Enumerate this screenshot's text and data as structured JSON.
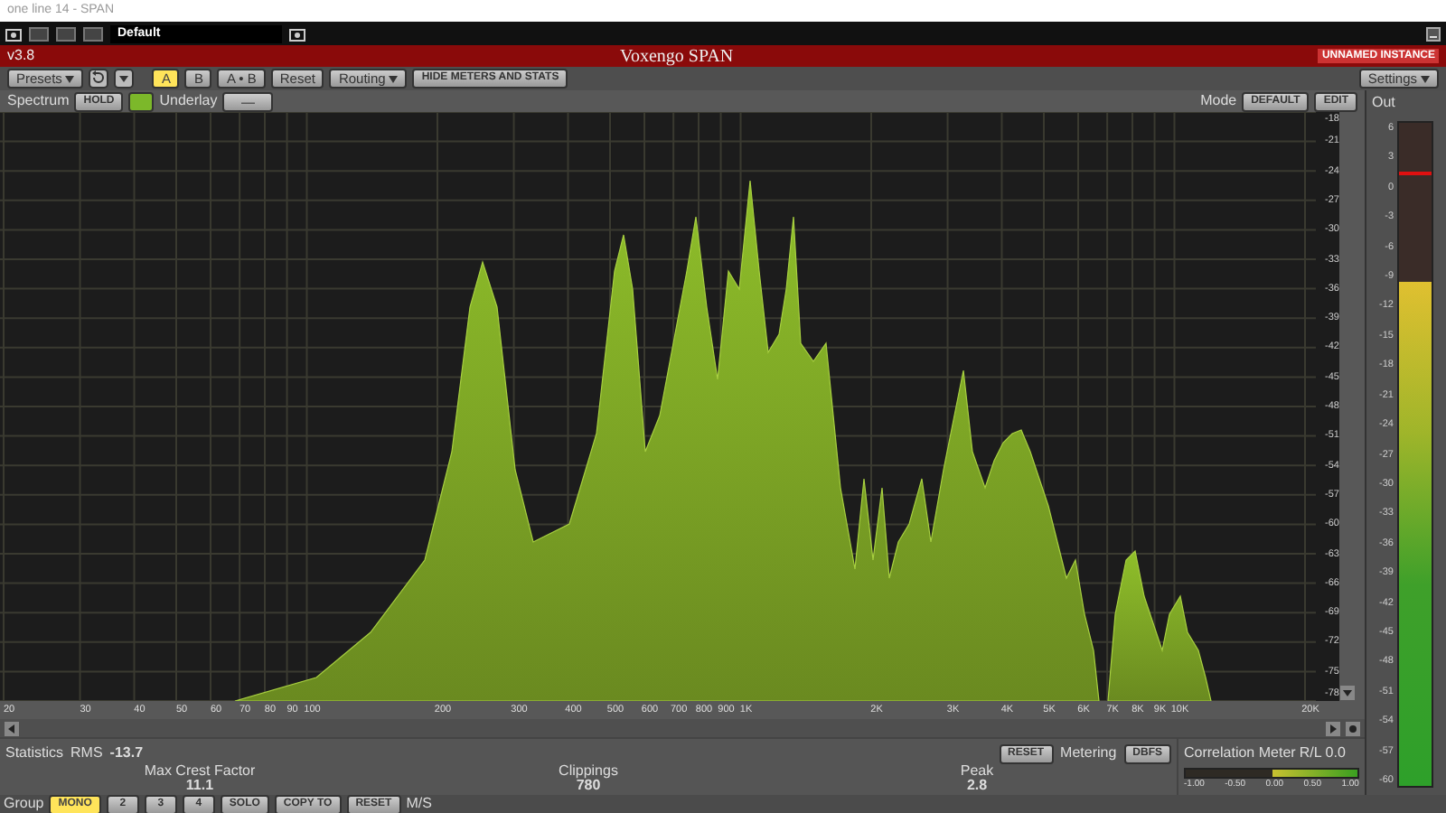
{
  "window": {
    "title": "one line 14 - SPAN"
  },
  "host_bar": {
    "preset": "Default"
  },
  "header": {
    "version": "v3.8",
    "title": "Voxengo SPAN",
    "instance": "UNNAMED INSTANCE"
  },
  "toolbar": {
    "presets": "Presets",
    "ab": [
      {
        "label": "A",
        "selected": true
      },
      {
        "label": "B",
        "selected": false
      }
    ],
    "buttons": [
      "A • B",
      "Reset"
    ],
    "routing": "Routing",
    "hide": "HIDE METERS AND STATS",
    "settings": "Settings"
  },
  "spectrum_bar": {
    "tab": "Spectrum",
    "hold": "HOLD",
    "underlay_label": "Underlay",
    "underlay_value": "—",
    "mode_label": "Mode",
    "modes": [
      "DEFAULT",
      "EDIT"
    ]
  },
  "spectrum": {
    "x_labels": [
      "20",
      "30",
      "40",
      "50",
      "60",
      "70",
      "80",
      "90",
      "100",
      "200",
      "300",
      "400",
      "500",
      "600",
      "700",
      "800",
      "900",
      "1K",
      "2K",
      "3K",
      "4K",
      "5K",
      "6K",
      "7K",
      "8K",
      "9K",
      "10K",
      "20K"
    ],
    "y_labels": [
      "-18",
      "-21",
      "-24",
      "-27",
      "-30",
      "-33",
      "-36",
      "-39",
      "-42",
      "-45",
      "-48",
      "-51",
      "-54",
      "-57",
      "-60",
      "-63",
      "-66",
      "-69",
      "-72",
      "-75",
      "-78"
    ]
  },
  "out_meter": {
    "title": "Out",
    "scale": [
      "6",
      "3",
      "0",
      "-3",
      "-6",
      "-9",
      "-12",
      "-15",
      "-18",
      "-21",
      "-24",
      "-27",
      "-30",
      "-33",
      "-36",
      "-39",
      "-42",
      "-45",
      "-48",
      "-51",
      "-54",
      "-57",
      "-60"
    ],
    "level": 0.76,
    "peak_hold": {
      "level": 0.92
    }
  },
  "statistics": {
    "tab": "Statistics",
    "rms_label": "RMS",
    "rms_value": "-13.7",
    "items": [
      {
        "label": "Max Crest Factor",
        "value": "11.1"
      },
      {
        "label": "Clippings",
        "value": "780"
      },
      {
        "label": "Peak",
        "value": "2.8"
      }
    ],
    "reset": "RESET",
    "metering_label": "Metering",
    "metering_value": "DBFS"
  },
  "correlation": {
    "title": "Correlation Meter",
    "channel": "R/L",
    "value": "0.0",
    "level": 0.5,
    "scale": [
      "-1.00",
      "-0.50",
      "0.00",
      "0.50",
      "1.00"
    ]
  },
  "group_bar": {
    "label": "Group",
    "groups": [
      {
        "label": "MONO",
        "selected": true
      },
      {
        "label": "2",
        "selected": false
      },
      {
        "label": "3",
        "selected": false
      },
      {
        "label": "4",
        "selected": false
      }
    ],
    "buttons": [
      "SOLO",
      "COPY TO",
      "RESET"
    ],
    "mode": "M/S"
  }
}
